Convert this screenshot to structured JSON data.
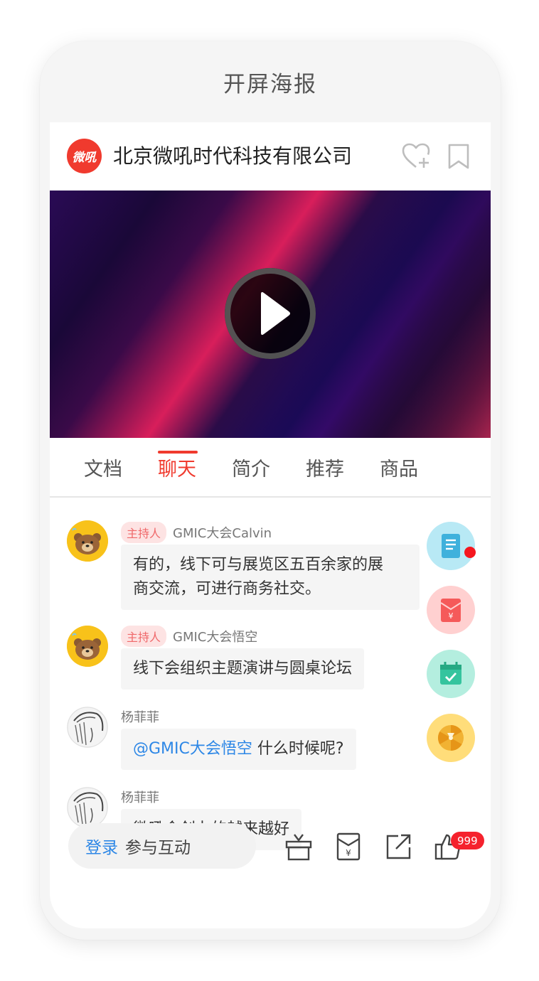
{
  "page_title": "开屏海报",
  "header": {
    "logo_text": "微吼",
    "company_name": "北京微吼时代科技有限公司"
  },
  "tabs": [
    {
      "label": "文档",
      "active": false
    },
    {
      "label": "聊天",
      "active": true
    },
    {
      "label": "简介",
      "active": false
    },
    {
      "label": "推荐",
      "active": false
    },
    {
      "label": "商品",
      "active": false
    }
  ],
  "messages": [
    {
      "badge": "主持人",
      "name": "GMIC大会Calvin",
      "text_line1": "有的，线下可与展览区五百余家的展",
      "text_line2": "商交流，可进行商务社交。"
    },
    {
      "badge": "主持人",
      "name": "GMIC大会悟空",
      "text": "线下会组织主题演讲与圆桌论坛"
    },
    {
      "name": "杨菲菲",
      "mention": "@GMIC大会悟空",
      "text": " 什么时候呢?"
    },
    {
      "name": "杨菲菲",
      "text": "微吼会创办的越来越好"
    }
  ],
  "side_buttons": [
    {
      "icon": "document-icon",
      "color": "#b8e9f5"
    },
    {
      "icon": "red-envelope-icon",
      "color": "#ffd0d0"
    },
    {
      "icon": "calendar-check-icon",
      "color": "#b4eedf"
    },
    {
      "icon": "lottery-wheel-icon",
      "color": "#ffdd7a"
    }
  ],
  "bottom_bar": {
    "login_label": "登录",
    "input_label": "参与互动",
    "like_count": "999"
  },
  "colors": {
    "accent": "#f03a2e",
    "link": "#2d87e6"
  }
}
